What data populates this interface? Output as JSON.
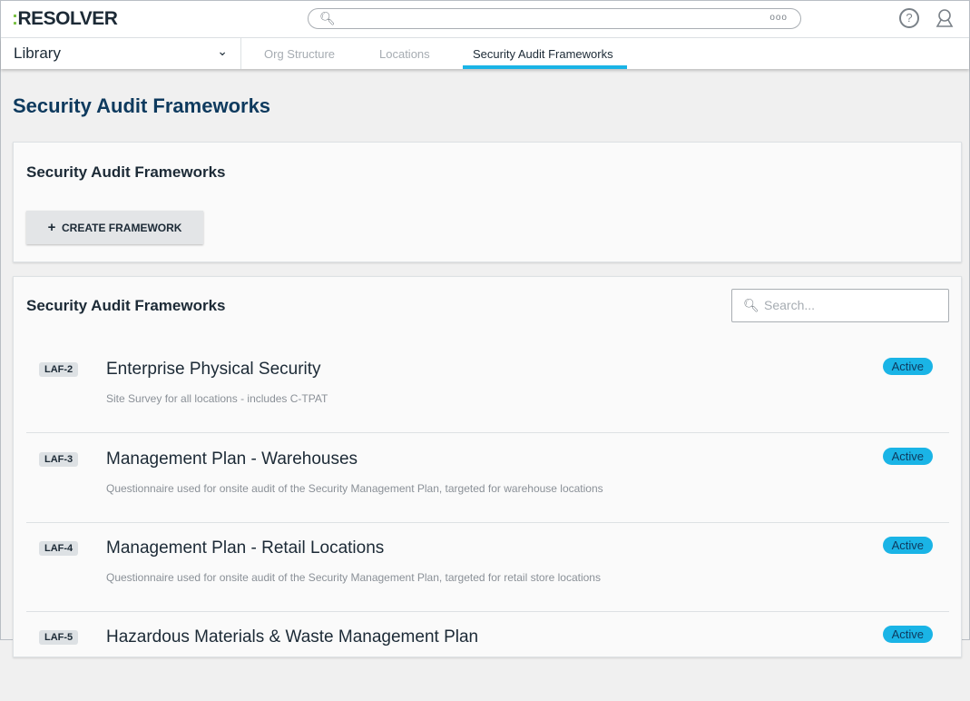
{
  "header": {
    "logo": "RESOLVER",
    "search_placeholder": "",
    "more": "ooo"
  },
  "nav": {
    "library": "Library",
    "tabs": [
      "Org Structure",
      "Locations",
      "Security Audit Frameworks"
    ]
  },
  "page_title": "Security Audit Frameworks",
  "create_card": {
    "title": "Security Audit Frameworks",
    "button": "CREATE FRAMEWORK"
  },
  "list_card": {
    "title": "Security Audit Frameworks",
    "search_placeholder": "Search...",
    "items": [
      {
        "id": "LAF-2",
        "title": "Enterprise Physical Security",
        "desc": "Site Survey for all locations - includes C-TPAT",
        "status": "Active"
      },
      {
        "id": "LAF-3",
        "title": "Management Plan - Warehouses",
        "desc": "Questionnaire used for onsite audit of the Security Management Plan, targeted for warehouse locations",
        "status": "Active"
      },
      {
        "id": "LAF-4",
        "title": "Management Plan - Retail Locations",
        "desc": "Questionnaire used for onsite audit of the Security Management Plan, targeted for retail store locations",
        "status": "Active"
      },
      {
        "id": "LAF-5",
        "title": "Hazardous Materials & Waste Management Plan",
        "desc": "",
        "status": "Active"
      }
    ]
  }
}
